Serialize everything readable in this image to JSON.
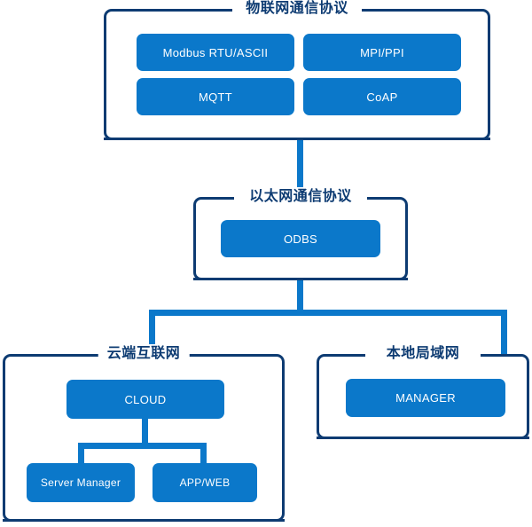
{
  "diagram": {
    "title_colors": {
      "frame_border": "#0d3b72",
      "frame_title_text": "#0d3b72",
      "node_fill": "#0b78ca",
      "node_text": "#ffffff",
      "connector": "#0b78ca",
      "background": "#ffffff"
    },
    "groups": {
      "iot": {
        "title": "物联网通信协议",
        "nodes": [
          {
            "label": "Modbus RTU/ASCII"
          },
          {
            "label": "MPI/PPI"
          },
          {
            "label": "MQTT"
          },
          {
            "label": "CoAP"
          }
        ]
      },
      "ethernet": {
        "title": "以太网通信协议",
        "nodes": [
          {
            "label": "ODBS"
          }
        ]
      },
      "cloud": {
        "title": "云端互联网",
        "nodes": [
          {
            "label": "CLOUD"
          },
          {
            "label": "Server Manager"
          },
          {
            "label": "APP/WEB"
          }
        ]
      },
      "lan": {
        "title": "本地局域网",
        "nodes": [
          {
            "label": "MANAGER"
          }
        ]
      }
    }
  }
}
